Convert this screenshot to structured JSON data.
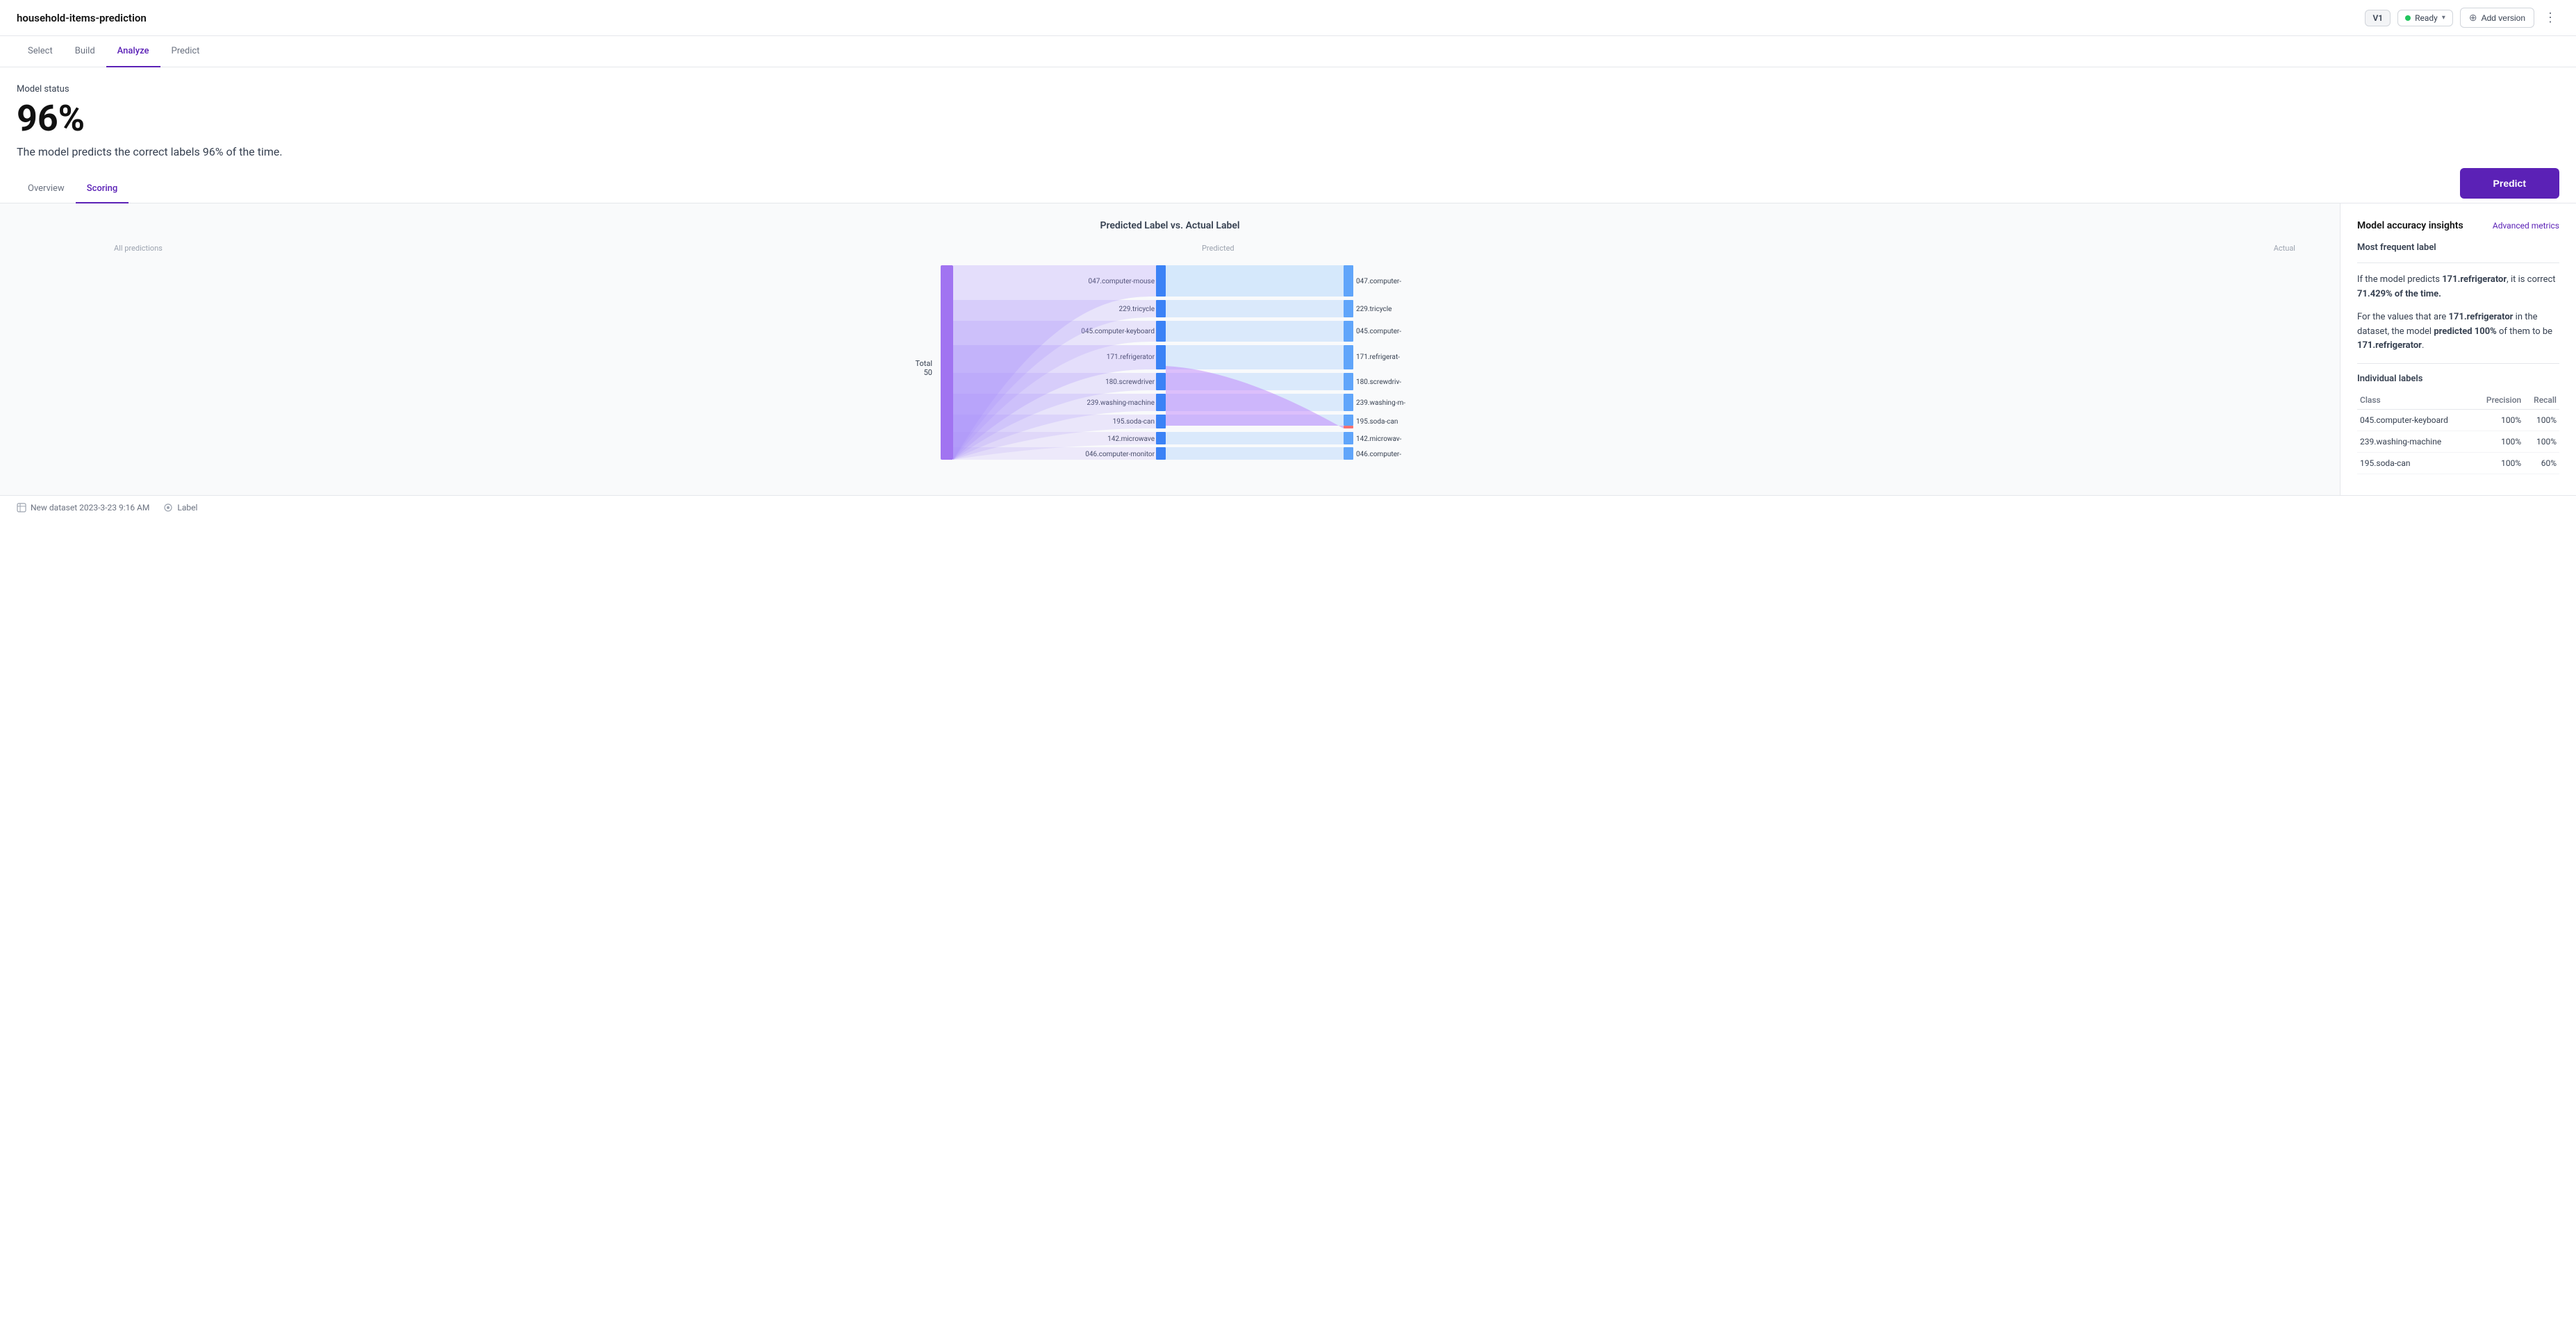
{
  "header": {
    "title": "household-items-prediction",
    "version": "V1",
    "status": "Ready",
    "add_version_label": "Add version",
    "nav_tabs": [
      {
        "id": "select",
        "label": "Select"
      },
      {
        "id": "build",
        "label": "Build"
      },
      {
        "id": "analyze",
        "label": "Analyze",
        "active": true
      },
      {
        "id": "predict",
        "label": "Predict"
      }
    ]
  },
  "model_status": {
    "section_label": "Model status",
    "accuracy": "96%",
    "description": "The model predicts the correct labels 96% of the time.",
    "predict_button_label": "Predict"
  },
  "sub_tabs": [
    {
      "id": "overview",
      "label": "Overview"
    },
    {
      "id": "scoring",
      "label": "Scoring",
      "active": true
    }
  ],
  "chart": {
    "title": "Predicted Label vs. Actual Label",
    "col_all_predictions": "All predictions",
    "col_predicted": "Predicted",
    "col_actual": "Actual",
    "total_label": "Total",
    "total_value": "50",
    "rows": [
      {
        "predicted": "047.computer-mouse",
        "actual": "047.computer-"
      },
      {
        "predicted": "229.tricycle",
        "actual": "229.tricycle"
      },
      {
        "predicted": "045.computer-keyboard",
        "actual": "045.computer-"
      },
      {
        "predicted": "171.refrigerator",
        "actual": "171.refrigerat-"
      },
      {
        "predicted": "180.screwdriver",
        "actual": "180.screwdriv-"
      },
      {
        "predicted": "239.washing-machine",
        "actual": "239.washing-m-"
      },
      {
        "predicted": "195.soda-can",
        "actual": "195.soda-can"
      },
      {
        "predicted": "142.microwave",
        "actual": "142.microwav-"
      },
      {
        "predicted": "046.computer-monitor",
        "actual": "046.computer-"
      }
    ]
  },
  "right_panel": {
    "title": "Model accuracy insights",
    "advanced_link": "Advanced metrics",
    "most_frequent_label": "Most frequent label",
    "insight_1": "If the model predicts 171.refrigerator, it is correct 71.429% of the time.",
    "insight_2": "For the values that are 171.refrigerator in the dataset, the model predicted 100% of them to be 171.refrigerator.",
    "individual_labels": "Individual labels",
    "table_headers": [
      "Class",
      "Precision",
      "Recall"
    ],
    "table_rows": [
      {
        "class": "045.computer-keyboard",
        "precision": "100%",
        "recall": "100%"
      },
      {
        "class": "239.washing-machine",
        "precision": "100%",
        "recall": "100%"
      },
      {
        "class": "195.soda-can",
        "precision": "100%",
        "recall": "60%"
      }
    ]
  },
  "footer": {
    "dataset_label": "New dataset 2023-3-23 9:16 AM",
    "target_label": "Label"
  }
}
